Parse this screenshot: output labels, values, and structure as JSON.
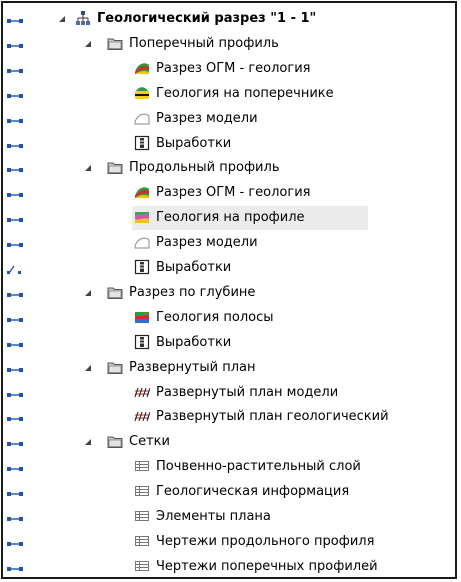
{
  "colors": {
    "pin": "#2255aa",
    "folder": "#c9c9c9",
    "highlight": "#ececec"
  },
  "tree": [
    {
      "level": 0,
      "expandable": true,
      "icon": "hierarchy-icon",
      "label": "Геологический разрез \"1 - 1\"",
      "root": true
    },
    {
      "level": 1,
      "expandable": true,
      "icon": "folder-icon",
      "label": "Поперечный профиль"
    },
    {
      "level": 2,
      "icon": "geology-ogm-icon",
      "label": "Разрез ОГМ - геология"
    },
    {
      "level": 2,
      "icon": "geology-layers-icon",
      "label": "Геология на поперечнике"
    },
    {
      "level": 2,
      "icon": "model-section-icon",
      "label": "Разрез модели"
    },
    {
      "level": 2,
      "icon": "workings-icon",
      "label": "Выработки"
    },
    {
      "level": 1,
      "expandable": true,
      "icon": "folder-icon",
      "label": "Продольный профиль"
    },
    {
      "level": 2,
      "icon": "geology-ogm-icon",
      "label": "Разрез ОГМ - геология"
    },
    {
      "level": 2,
      "icon": "geology-profile-icon",
      "label": "Геология на профиле",
      "highlight": true
    },
    {
      "level": 2,
      "icon": "model-section-icon",
      "label": "Разрез модели"
    },
    {
      "level": 2,
      "icon": "workings-icon",
      "label": "Выработки",
      "pinOpen": true
    },
    {
      "level": 1,
      "expandable": true,
      "icon": "folder-icon",
      "label": "Разрез по глубине"
    },
    {
      "level": 2,
      "icon": "geology-strip-icon",
      "label": "Геология полосы"
    },
    {
      "level": 2,
      "icon": "workings-icon",
      "label": "Выработки"
    },
    {
      "level": 1,
      "expandable": true,
      "icon": "folder-icon",
      "label": "Развернутый план"
    },
    {
      "level": 2,
      "icon": "unfolded-plan-icon",
      "label": "Развернутый план модели"
    },
    {
      "level": 2,
      "icon": "unfolded-plan-icon",
      "label": "Развернутый план геологический"
    },
    {
      "level": 1,
      "expandable": true,
      "icon": "folder-icon",
      "label": "Сетки"
    },
    {
      "level": 2,
      "icon": "grid-icon",
      "label": "Почвенно-растительный слой"
    },
    {
      "level": 2,
      "icon": "grid-icon",
      "label": "Геологическая информация"
    },
    {
      "level": 2,
      "icon": "grid-icon",
      "label": "Элементы плана"
    },
    {
      "level": 2,
      "icon": "grid-icon",
      "label": "Чертежи продольного профиля"
    },
    {
      "level": 2,
      "icon": "grid-icon",
      "label": "Чертежи поперечных профилей"
    }
  ]
}
